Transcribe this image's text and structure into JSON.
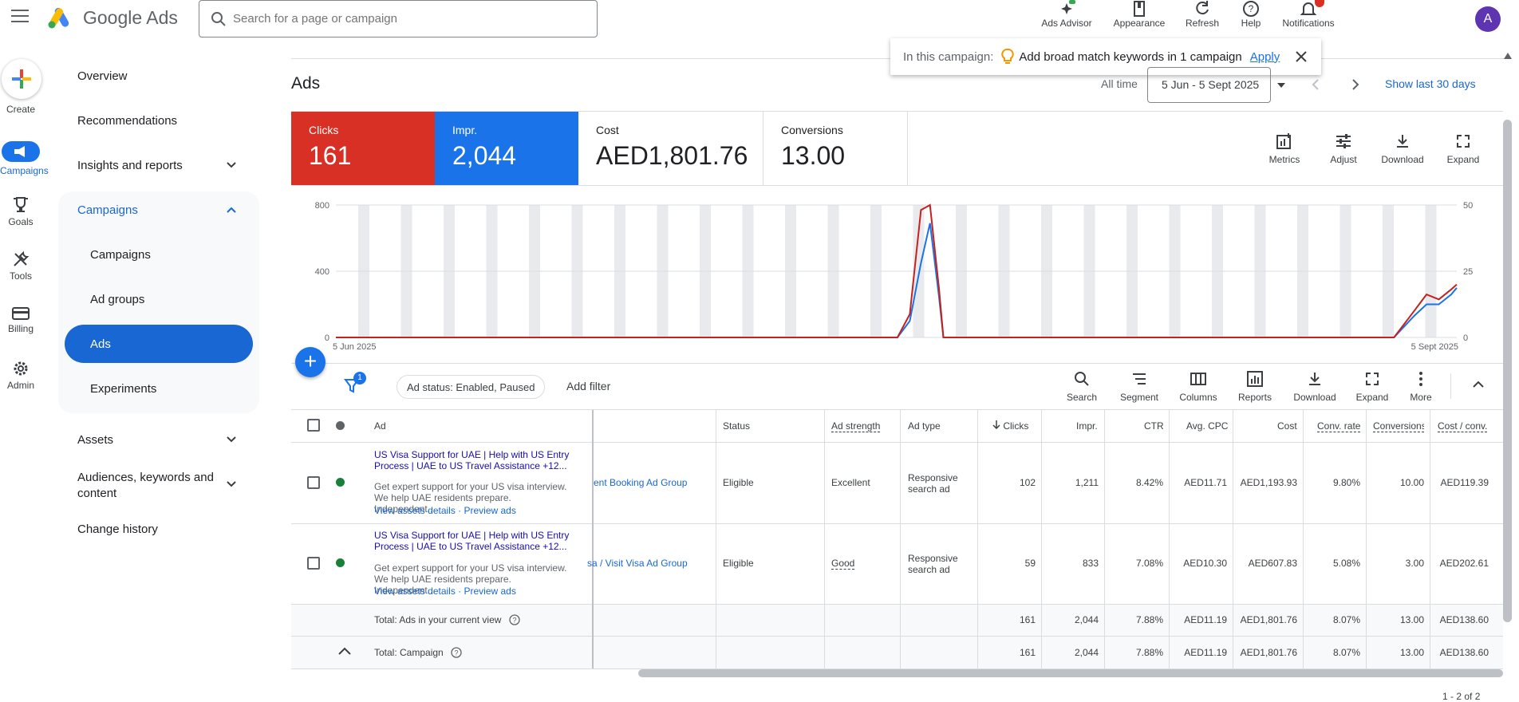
{
  "header": {
    "brand": "Google Ads",
    "search_placeholder": "Search for a page or campaign",
    "tools": [
      "Ads Advisor",
      "Appearance",
      "Refresh",
      "Help",
      "Notifications"
    ],
    "avatar_initial": "A"
  },
  "rail": {
    "create": "Create",
    "campaigns": "Campaigns",
    "goals": "Goals",
    "tools": "Tools",
    "billing": "Billing",
    "admin": "Admin"
  },
  "nav": {
    "overview": "Overview",
    "recommendations": "Recommendations",
    "insights": "Insights and reports",
    "campaigns_group": "Campaigns",
    "sub": [
      "Campaigns",
      "Ad groups",
      "Ads",
      "Experiments"
    ],
    "assets": "Assets",
    "audiences": "Audiences, keywords and content",
    "change_history": "Change history"
  },
  "page": {
    "title": "Ads",
    "promo_label": "In this campaign:",
    "promo_text": "Add broad match keywords in 1 campaign",
    "promo_apply": "Apply",
    "all_time": "All time",
    "date_range": "5 Jun - 5 Sept 2025",
    "show_last": "Show last 30 days"
  },
  "metrics": [
    {
      "label": "Clicks",
      "value": "161",
      "color": "#d93025"
    },
    {
      "label": "Impr.",
      "value": "2,044",
      "color": "#1a73e8"
    },
    {
      "label": "Cost",
      "value": "AED1,801.76",
      "color": "#ffffff"
    },
    {
      "label": "Conversions",
      "value": "13.00",
      "color": "#ffffff"
    }
  ],
  "chart_tools": [
    "Metrics",
    "Adjust",
    "Download",
    "Expand"
  ],
  "chart_data": {
    "type": "line",
    "x_start_label": "5 Jun 2025",
    "x_end_label": "5 Sept 2025",
    "left_ticks": [
      "800",
      "400",
      "0"
    ],
    "right_ticks": [
      "50",
      "25",
      "0"
    ],
    "ylim_left": [
      0,
      800
    ],
    "ylim_right": [
      0,
      50
    ],
    "series": [
      {
        "color": "#c5221f",
        "axis": "left",
        "points": [
          [
            0,
            0
          ],
          [
            0.501,
            0
          ],
          [
            0.512,
            140
          ],
          [
            0.522,
            770
          ],
          [
            0.53,
            800
          ],
          [
            0.538,
            300
          ],
          [
            0.542,
            0
          ],
          [
            0.944,
            0
          ],
          [
            0.962,
            160
          ],
          [
            0.973,
            260
          ],
          [
            0.984,
            230
          ],
          [
            0.995,
            290
          ],
          [
            1,
            320
          ]
        ]
      },
      {
        "color": "#1a73e8",
        "axis": "left",
        "points": [
          [
            0,
            0
          ],
          [
            0.501,
            0
          ],
          [
            0.512,
            100
          ],
          [
            0.522,
            450
          ],
          [
            0.53,
            690
          ],
          [
            0.538,
            250
          ],
          [
            0.542,
            0
          ],
          [
            0.944,
            0
          ],
          [
            0.962,
            130
          ],
          [
            0.973,
            200
          ],
          [
            0.984,
            200
          ],
          [
            0.995,
            260
          ],
          [
            1,
            300
          ]
        ]
      }
    ],
    "grid": true
  },
  "table_toolbar": {
    "filter_badge": "1",
    "filter_chip": "Ad status: Enabled, Paused",
    "add_filter": "Add filter",
    "tools": [
      "Search",
      "Segment",
      "Columns",
      "Reports",
      "Download",
      "Expand",
      "More"
    ]
  },
  "table": {
    "headers": [
      "Ad",
      "Status",
      "Ad strength",
      "Ad type",
      "Clicks",
      "Impr.",
      "CTR",
      "Avg. CPC",
      "Cost",
      "Conv. rate",
      "Conversions",
      "Cost / conv."
    ],
    "rows": [
      {
        "title": "US Visa Support for UAE | Help with US Entry Process | UAE to US Travel Assistance  +12...",
        "desc": "Get expert support for your US visa interview. We help UAE residents prepare. Independent...",
        "links": "View assets details · Preview ads",
        "adgroup": "ent Booking Ad Group",
        "status": "Eligible",
        "strength": "Excellent",
        "adtype": "Responsive search ad",
        "clicks": "102",
        "impr": "1,211",
        "ctr": "8.42%",
        "cpc": "AED11.71",
        "cost": "AED1,193.93",
        "convrate": "9.80%",
        "conv": "10.00",
        "costconv": "AED119.39"
      },
      {
        "title": "US Visa Support for UAE | Help with US Entry Process | UAE to US Travel Assistance  +12...",
        "desc": "Get expert support for your US visa interview. We help UAE residents prepare. Independent...",
        "links": "View assets details · Preview ads",
        "adgroup": "sa / Visit Visa Ad Group",
        "status": "Eligible",
        "strength": "Good",
        "adtype": "Responsive search ad",
        "clicks": "59",
        "impr": "833",
        "ctr": "7.08%",
        "cpc": "AED10.30",
        "cost": "AED607.83",
        "convrate": "5.08%",
        "conv": "3.00",
        "costconv": "AED202.61"
      }
    ],
    "totals": [
      {
        "label": "Total: Ads in your current view",
        "clicks": "161",
        "impr": "2,044",
        "ctr": "7.88%",
        "cpc": "AED11.19",
        "cost": "AED1,801.76",
        "convrate": "8.07%",
        "conv": "13.00",
        "costconv": "AED138.60"
      },
      {
        "label": "Total: Campaign",
        "clicks": "161",
        "impr": "2,044",
        "ctr": "7.88%",
        "cpc": "AED11.19",
        "cost": "AED1,801.76",
        "convrate": "8.07%",
        "conv": "13.00",
        "costconv": "AED138.60"
      }
    ],
    "pagination": "1 - 2 of 2"
  }
}
